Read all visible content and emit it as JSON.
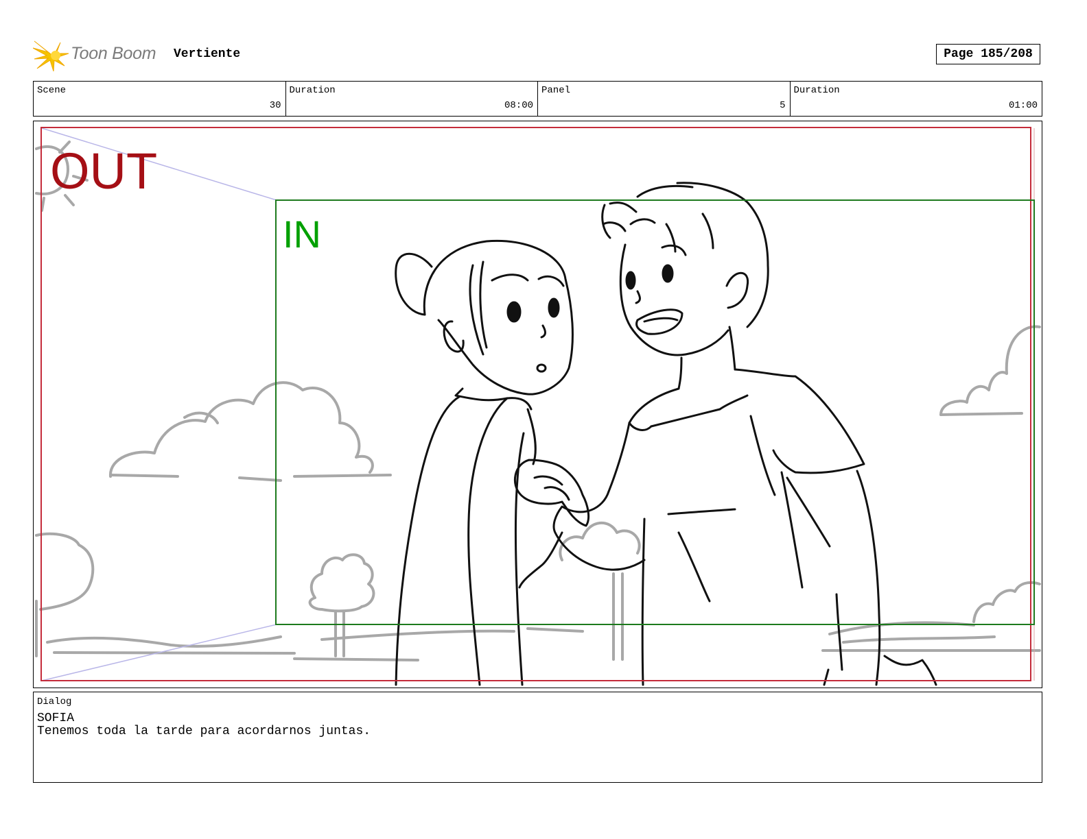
{
  "header": {
    "logo_text": "Toon Boom",
    "project_title": "Vertiente",
    "page_label": "Page 185/208"
  },
  "info": {
    "scene_label": "Scene",
    "scene_value": "30",
    "scene_duration_label": "Duration",
    "scene_duration_value": "08:00",
    "panel_label": "Panel",
    "panel_value": "5",
    "panel_duration_label": "Duration",
    "panel_duration_value": "01:00"
  },
  "panel": {
    "out_label": "OUT",
    "in_label": "IN",
    "out_color": "#a50f15",
    "in_color": "#00a000",
    "in_frame_color": "#1d7a1d",
    "sketch_grey": "#a8a8a8"
  },
  "dialog": {
    "label": "Dialog",
    "speaker": "SOFIA",
    "line": "Tenemos toda la tarde para acordarnos juntas."
  }
}
